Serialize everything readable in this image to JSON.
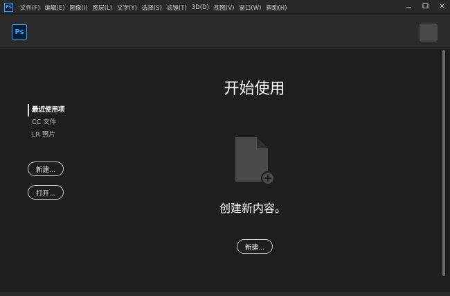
{
  "app": {
    "small_icon_text": "Ps",
    "logo_text": "Ps"
  },
  "menu": [
    "文件(F)",
    "编辑(E)",
    "图像(I)",
    "图层(L)",
    "文字(Y)",
    "选择(S)",
    "滤镜(T)",
    "3D(D)",
    "视图(V)",
    "窗口(W)",
    "帮助(H)"
  ],
  "sidebar": {
    "links": [
      "最近使用项",
      "CC 文件",
      "LR 照片"
    ],
    "new_button": "新建...",
    "open_button": "打开..."
  },
  "main": {
    "title": "开始使用",
    "subtitle": "创建新内容。",
    "new_button": "新建..."
  },
  "colors": {
    "accent": "#31a8ff",
    "background": "#1e1e1e",
    "header": "#2b2b2b"
  },
  "icons": [
    "minimize-icon",
    "maximize-icon",
    "close-icon",
    "new-document-icon",
    "plus-icon"
  ]
}
